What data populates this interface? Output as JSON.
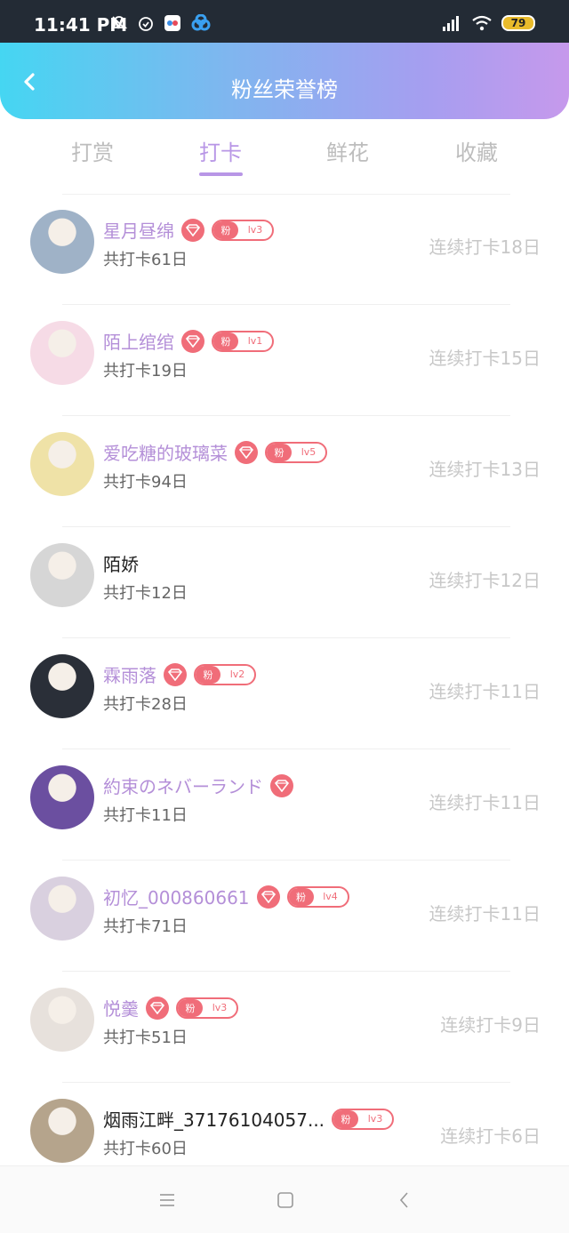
{
  "status_bar": {
    "time": "11:41 PM",
    "battery": "79",
    "left_icons": [
      "mute-bell-icon",
      "alarm-icon",
      "app-icon",
      "link-icon"
    ],
    "right_icons": [
      "signal-icon",
      "wifi-icon",
      "battery-icon"
    ]
  },
  "header": {
    "title": "粉丝荣誉榜"
  },
  "tabs": [
    {
      "label": "打赏",
      "active": false
    },
    {
      "label": "打卡",
      "active": true
    },
    {
      "label": "鲜花",
      "active": false
    },
    {
      "label": "收藏",
      "active": false
    }
  ],
  "rows": [
    {
      "name": "星月昼绵",
      "name_colored": true,
      "diamond": true,
      "fan_label": "粉",
      "level": "lv3",
      "total": "共打卡61日",
      "streak": "连续打卡18日",
      "avatar_color": "#9fb2c7"
    },
    {
      "name": "陌上绾绾",
      "name_colored": true,
      "diamond": true,
      "fan_label": "粉",
      "level": "lv1",
      "total": "共打卡19日",
      "streak": "连续打卡15日",
      "avatar_color": "#f6dbe6"
    },
    {
      "name": "爱吃糖的玻璃菜",
      "name_colored": true,
      "diamond": true,
      "fan_label": "粉",
      "level": "lv5",
      "total": "共打卡94日",
      "streak": "连续打卡13日",
      "avatar_color": "#efe2a7"
    },
    {
      "name": "陌娇",
      "name_colored": false,
      "diamond": false,
      "fan_label": "",
      "level": "",
      "total": "共打卡12日",
      "streak": "连续打卡12日",
      "avatar_color": "#d6d6d6"
    },
    {
      "name": "霖雨落",
      "name_colored": true,
      "diamond": true,
      "fan_label": "粉",
      "level": "lv2",
      "total": "共打卡28日",
      "streak": "连续打卡11日",
      "avatar_color": "#2a2f38"
    },
    {
      "name": "約束のネバーランド",
      "name_colored": true,
      "diamond": true,
      "fan_label": "",
      "level": "",
      "total": "共打卡11日",
      "streak": "连续打卡11日",
      "avatar_color": "#6b4fa0"
    },
    {
      "name": "初忆_000860661",
      "name_colored": true,
      "diamond": true,
      "fan_label": "粉",
      "level": "lv4",
      "total": "共打卡71日",
      "streak": "连续打卡11日",
      "avatar_color": "#d9d0df"
    },
    {
      "name": "悦羹",
      "name_colored": true,
      "diamond": true,
      "fan_label": "粉",
      "level": "lv3",
      "total": "共打卡51日",
      "streak": "连续打卡9日",
      "avatar_color": "#e7e1dc"
    },
    {
      "name": "烟雨江畔_37176104057...",
      "name_colored": false,
      "diamond": false,
      "fan_label": "粉",
      "level": "lv3",
      "total": "共打卡60日",
      "streak": "连续打卡6日",
      "avatar_color": "#b5a48c"
    }
  ],
  "nav": {
    "icons": [
      "menu-icon",
      "home-icon",
      "back-icon"
    ]
  }
}
